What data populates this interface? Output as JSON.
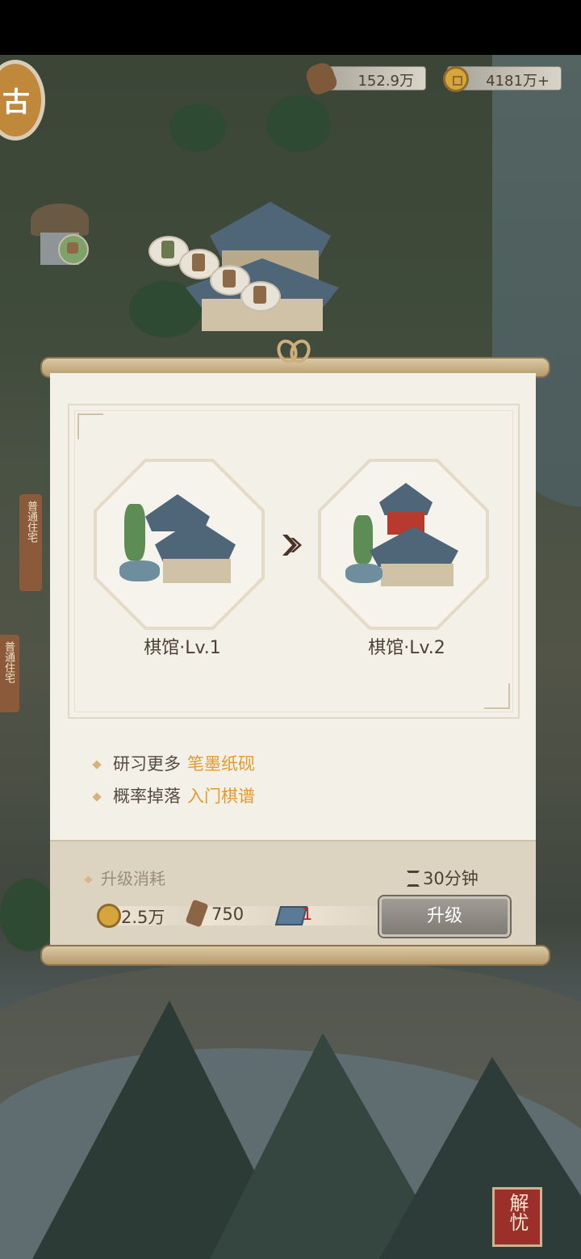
{
  "resources": {
    "wood": "152.9万",
    "coins": "4181万+"
  },
  "side_tags": {
    "tag1": "普通住宅",
    "tag2": "普通住宅"
  },
  "dialog": {
    "current_level_label": "棋馆·Lv.1",
    "next_level_label": "棋馆·Lv.2",
    "features": [
      {
        "prefix": "研习更多",
        "highlight": "笔墨纸砚"
      },
      {
        "prefix": "概率掉落",
        "highlight": "入门棋谱"
      }
    ],
    "cost_title": "升级消耗",
    "time": "30分钟",
    "costs": {
      "coin": "2.5万",
      "wood": "750",
      "book": "1"
    },
    "upgrade_button": "升级"
  },
  "corner_button": "解忧",
  "colors": {
    "highlight": "#e39b2d",
    "book_cost_insufficient": "#c0292a",
    "upgrade_button": "#8e8a84"
  }
}
